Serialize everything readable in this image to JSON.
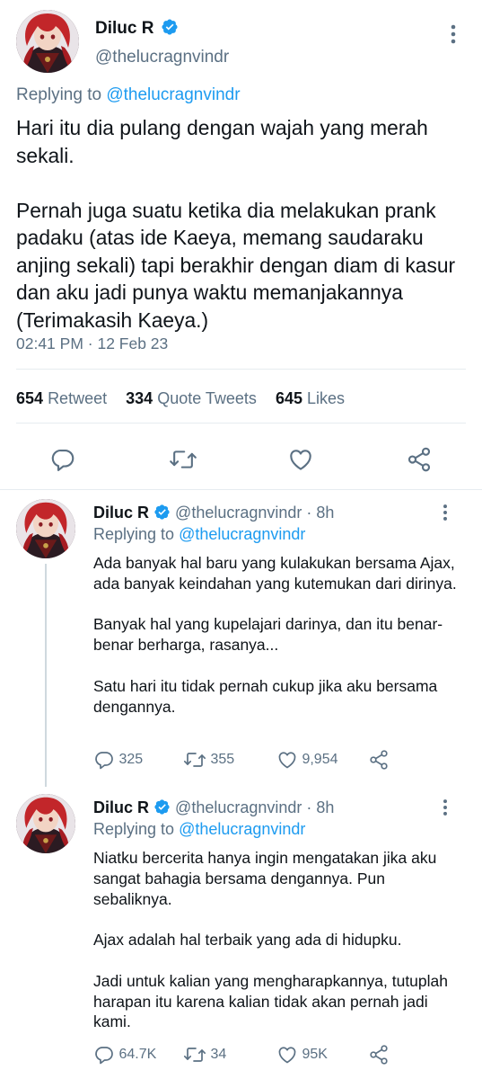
{
  "main_tweet": {
    "display_name": "Diluc R",
    "handle": "@thelucragnvindr",
    "replying_prefix": "Replying to",
    "replying_handle": "@thelucragnvindr",
    "text": "Hari itu dia pulang dengan wajah yang merah sekali.\n\nPernah juga suatu ketika dia melakukan prank padaku (atas ide Kaeya, memang saudaraku anjing sekali) tapi berakhir dengan diam di kasur dan aku jadi punya waktu memanjakannya (Terimakasih Kaeya.)",
    "timestamp": "02:41 PM · 12 Feb 23",
    "stats": {
      "retweets_count": "654",
      "retweets_label": "Retweet",
      "quotes_count": "334",
      "quotes_label": "Quote Tweets",
      "likes_count": "645",
      "likes_label": "Likes"
    },
    "icons": [
      "reply-icon",
      "retweet-icon",
      "like-icon",
      "share-icon",
      "more-icon",
      "verified-icon"
    ]
  },
  "replies": [
    {
      "display_name": "Diluc R",
      "handle": "@thelucragnvindr",
      "time": "· 8h",
      "replying_prefix": "Replying to",
      "replying_handle": "@thelucragnvindr",
      "text": "Ada banyak hal baru yang kulakukan bersama Ajax, ada banyak keindahan yang kutemukan dari dirinya.\n\nBanyak hal yang kupelajari darinya, dan itu benar-benar berharga, rasanya...\n\nSatu hari itu tidak pernah cukup jika aku bersama dengannya.",
      "reply_count": "325",
      "retweet_count": "355",
      "like_count": "9,954"
    },
    {
      "display_name": "Diluc R",
      "handle": "@thelucragnvindr",
      "time": "· 8h",
      "replying_prefix": "Replying to",
      "replying_handle": "@thelucragnvindr",
      "text": "Niatku bercerita hanya ingin mengatakan jika aku sangat bahagia bersama dengannya. Pun sebaliknya.\n\nAjax adalah hal terbaik yang ada di hidupku.\n\nJadi untuk kalian yang mengharapkannya, tutuplah harapan itu karena kalian tidak akan pernah jadi kami.",
      "reply_count": "64.7K",
      "retweet_count": "34",
      "like_count": "95K"
    }
  ],
  "colors": {
    "accent": "#1d9bf0",
    "muted": "#5b7083",
    "text": "#0f1419",
    "divider": "#e6ecf0"
  }
}
